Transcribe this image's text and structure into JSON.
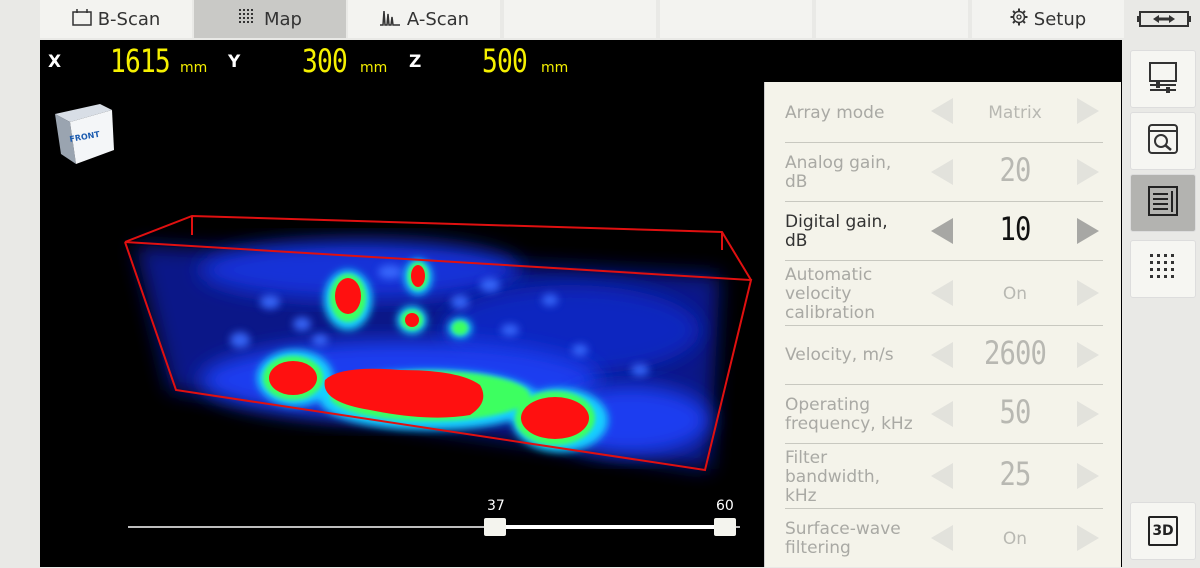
{
  "tabs": [
    {
      "label": "B-Scan",
      "icon": "b-scan-icon"
    },
    {
      "label": "Map",
      "icon": "map-grid-icon",
      "active": true
    },
    {
      "label": "A-Scan",
      "icon": "a-scan-icon"
    },
    {
      "label": ""
    },
    {
      "label": ""
    },
    {
      "label": ""
    },
    {
      "label": "Setup",
      "icon": "gear-icon"
    }
  ],
  "battery_icon": "battery-icon",
  "coordinates": {
    "x_axis": "X",
    "x_value": "1615",
    "x_unit": "mm",
    "y_axis": "Y",
    "y_value": "300",
    "y_unit": "mm",
    "z_axis": "Z",
    "z_value": "500",
    "z_unit": "mm"
  },
  "orientation_cube_label": "FRONT",
  "slider": {
    "min_label": "37",
    "max_label": "60"
  },
  "settings": [
    {
      "label": "Array mode",
      "value": "Matrix",
      "kind": "text"
    },
    {
      "label": "Analog gain, dB",
      "value": "20",
      "kind": "num"
    },
    {
      "label": "Digital gain, dB",
      "value": "10",
      "kind": "num",
      "active": true
    },
    {
      "label": "Automatic velocity calibration",
      "value": "On",
      "kind": "text"
    },
    {
      "label": "Velocity, m/s",
      "value": "2600",
      "kind": "num"
    },
    {
      "label": "Operating frequency, kHz",
      "value": "50",
      "kind": "num"
    },
    {
      "label": "Filter bandwidth, kHz",
      "value": "25",
      "kind": "num"
    },
    {
      "label": "Surface-wave filtering",
      "value": "On",
      "kind": "text"
    }
  ],
  "sidebar": [
    {
      "icon": "monitor-settings-icon"
    },
    {
      "icon": "zoom-window-icon"
    },
    {
      "icon": "list-menu-icon",
      "active": true
    },
    {
      "icon": "dot-grid-icon"
    },
    {
      "label": "3D",
      "icon": "3d-cube-icon"
    }
  ],
  "colors": {
    "accent_yellow": "#f5f000",
    "volume_outline": "#e01010",
    "panel_bg": "#f4f3ea"
  }
}
